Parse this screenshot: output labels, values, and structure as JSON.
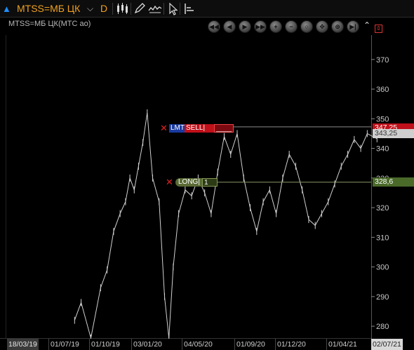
{
  "toolbar": {
    "ticker": "MTSS=МБ ЦК",
    "period": "D",
    "icons": [
      "triangle-up-icon",
      "chevron-down-icon",
      "candles-icon",
      "pencil-icon",
      "indicator-icon",
      "cursor-icon",
      "layout-icon"
    ]
  },
  "chart_title": "MTSS=МБ ЦК(МТС ао)",
  "nav_buttons": [
    "first",
    "prev",
    "play",
    "next",
    "last",
    "zoom-in",
    "zoom-out",
    "search",
    "move",
    "center",
    "end",
    "fit"
  ],
  "price_tags": {
    "sell_order": "347,25",
    "last": "343,25",
    "long_position": "328,6"
  },
  "orders": {
    "lmt_label": "LMT",
    "sell_label": "SELL|",
    "sell_qty": "____",
    "long_label": "LONG|",
    "long_qty": "1"
  },
  "colors": {
    "background": "#000000",
    "price_line": "#d0d0d0",
    "sell": "#c0101a",
    "long": "#4a6a2a",
    "ticker": "#f0a020"
  },
  "chart_data": {
    "type": "line",
    "title": "MTSS=МБ ЦК(МТС ао)",
    "xlabel": "",
    "ylabel": "",
    "ylim": [
      276,
      378
    ],
    "yticks": [
      280,
      290,
      300,
      310,
      320,
      330,
      340,
      350,
      360,
      370
    ],
    "xticks": [
      "18/03/19",
      "01/07/19",
      "01/10/19",
      "03/01/20",
      "04/05/20",
      "01/09/20",
      "01/12/20",
      "01/04/21",
      "02/07/21"
    ],
    "grid": false,
    "legend": "none",
    "series": [
      {
        "values": [
          {
            "x": "2019-08",
            "y": 282
          },
          {
            "x": "2019-08",
            "y": 288
          },
          {
            "x": "2019-09",
            "y": 276
          },
          {
            "x": "2019-10",
            "y": 293
          },
          {
            "x": "2019-10",
            "y": 299
          },
          {
            "x": "2019-11",
            "y": 312
          },
          {
            "x": "2019-11",
            "y": 318
          },
          {
            "x": "2019-12",
            "y": 322
          },
          {
            "x": "2019-12",
            "y": 330
          },
          {
            "x": "2019-12",
            "y": 326
          },
          {
            "x": "2020-01",
            "y": 334
          },
          {
            "x": "2020-01",
            "y": 342
          },
          {
            "x": "2020-01",
            "y": 352
          },
          {
            "x": "2020-02",
            "y": 330
          },
          {
            "x": "2020-02",
            "y": 322
          },
          {
            "x": "2020-03",
            "y": 290
          },
          {
            "x": "2020-03",
            "y": 276
          },
          {
            "x": "2020-03",
            "y": 300
          },
          {
            "x": "2020-04",
            "y": 318
          },
          {
            "x": "2020-04",
            "y": 326
          },
          {
            "x": "2020-05",
            "y": 324
          },
          {
            "x": "2020-05",
            "y": 330
          },
          {
            "x": "2020-06",
            "y": 325
          },
          {
            "x": "2020-06",
            "y": 318
          },
          {
            "x": "2020-07",
            "y": 332
          },
          {
            "x": "2020-07",
            "y": 344
          },
          {
            "x": "2020-08",
            "y": 338
          },
          {
            "x": "2020-08",
            "y": 345
          },
          {
            "x": "2020-09",
            "y": 330
          },
          {
            "x": "2020-09",
            "y": 320
          },
          {
            "x": "2020-10",
            "y": 312
          },
          {
            "x": "2020-10",
            "y": 322
          },
          {
            "x": "2020-11",
            "y": 326
          },
          {
            "x": "2020-11",
            "y": 318
          },
          {
            "x": "2020-12",
            "y": 330
          },
          {
            "x": "2020-12",
            "y": 338
          },
          {
            "x": "2021-01",
            "y": 334
          },
          {
            "x": "2021-01",
            "y": 326
          },
          {
            "x": "2021-02",
            "y": 316
          },
          {
            "x": "2021-02",
            "y": 314
          },
          {
            "x": "2021-03",
            "y": 318
          },
          {
            "x": "2021-03",
            "y": 322
          },
          {
            "x": "2021-04",
            "y": 328
          },
          {
            "x": "2021-04",
            "y": 334
          },
          {
            "x": "2021-05",
            "y": 338
          },
          {
            "x": "2021-05",
            "y": 343
          },
          {
            "x": "2021-06",
            "y": 340
          },
          {
            "x": "2021-06",
            "y": 345
          },
          {
            "x": "2021-07",
            "y": 343.25
          }
        ]
      }
    ],
    "hlines": [
      {
        "y": 347.25,
        "label": "SELL"
      },
      {
        "y": 328.6,
        "label": "LONG"
      }
    ]
  }
}
